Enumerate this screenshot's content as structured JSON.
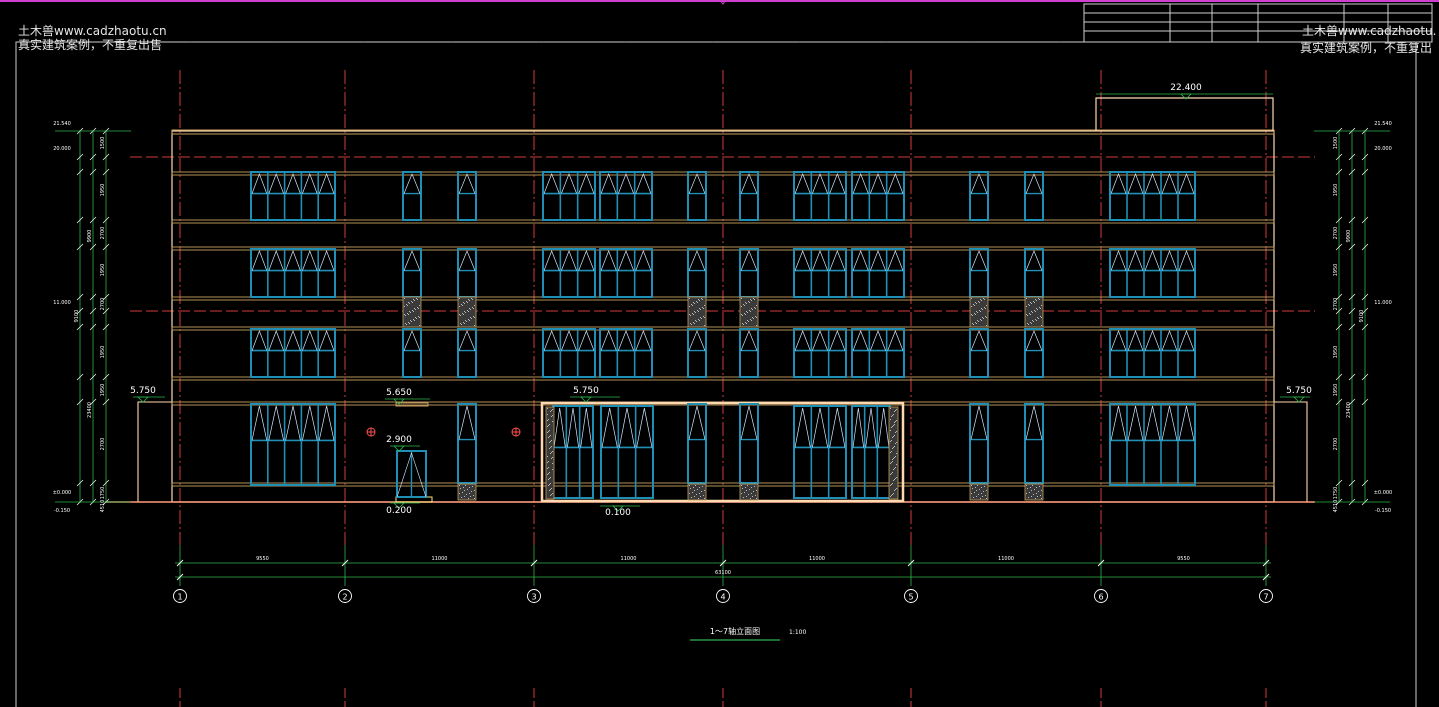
{
  "watermark": {
    "site": "土木兽www.cadzhaotu.cn",
    "note": "真实建筑案例，不重复出售",
    "site_right": "土木兽www.cadzhaotu.",
    "note_right": "真实建筑案例，不重复出"
  },
  "drawing": {
    "title": "1～7轴立面图",
    "scale": "1:100",
    "axis_labels": [
      "1",
      "2",
      "3",
      "4",
      "5",
      "6",
      "7"
    ],
    "span_dims": [
      "9550",
      "11000",
      "11000",
      "11000",
      "11000",
      "9550"
    ],
    "total_dim": "63100",
    "elevations": {
      "roof_top": "22.400",
      "parapet": "21.540",
      "roof": "20.000",
      "canopy_left": "5.750",
      "canopy_right": "5.750",
      "canopy_entry": "5.750",
      "canopy_small": "5.650",
      "door_head": "2.900",
      "step": "0.200",
      "entry_floor": "0.100",
      "ground": "±0.000",
      "outdoor": "-0.150",
      "mid_level": "11.000"
    },
    "left_dims": [
      "1500",
      "1950",
      "2700",
      "1950",
      "2700",
      "1950",
      "1950",
      "2700",
      "1750",
      "4510",
      "1000"
    ],
    "left_total_dims": [
      "9900",
      "9100",
      "23400"
    ]
  },
  "colors": {
    "background": "#000000",
    "axis": "#d23a3a",
    "outline": "#ffd8b0",
    "window": "#1f8fb5",
    "floor_band": "#c8a060",
    "dimension": "#2fb44a",
    "text": "#ffffff",
    "magenta_border": "#d040d0"
  }
}
